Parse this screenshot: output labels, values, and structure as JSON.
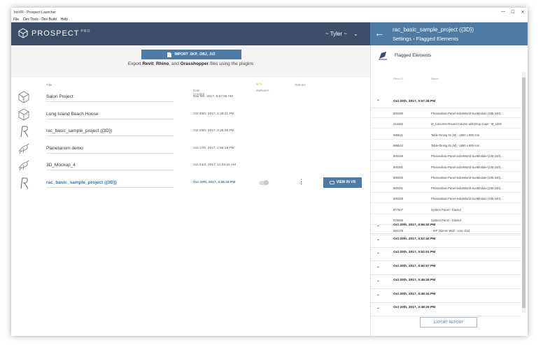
{
  "window": {
    "title": "IrisVR - Prospect Launcher",
    "controls": [
      "—",
      "☐",
      "✕"
    ]
  },
  "menu": [
    "File",
    "Dev Tools - Dev Build",
    "Help"
  ],
  "header": {
    "logo_text": "PROSPECT",
    "logo_suffix": "PRO",
    "user": "~ Tyler ~",
    "user_chevron": "⌄"
  },
  "import": {
    "button_label": "IMPORT .SKP, .OBJ, .IVZ",
    "hint_prefix": "Export ",
    "hint_revit": "Revit",
    "hint_sep1": ", ",
    "hint_rhino": "Rhino",
    "hint_sep2": ", and ",
    "hint_grasshopper": "Grasshopper",
    "hint_suffix": " files using the plugins"
  },
  "table": {
    "col_title": "Title",
    "col_date": "Date Created",
    "col_date_sort": "⌄",
    "col_multiuser": "Multiuser",
    "col_multiuser_badge": "BETA",
    "col_options": "Options",
    "rows": [
      {
        "name": "Salon Project",
        "date": "Nov 6th, 2017, 9:57:56 AM",
        "thumb": "cube"
      },
      {
        "name": "Long Island Beach House",
        "date": "Oct 30th, 2017, 1:29:41 PM",
        "thumb": "cube"
      },
      {
        "name": "rac_basic_sample_project ({3D})",
        "date": "Oct 20th, 2017, 3:25:26 PM",
        "thumb": "revit"
      },
      {
        "name": "Planetarium demo",
        "date": "Oct 17th, 2017, 2:56:19 PM",
        "thumb": "bird"
      },
      {
        "name": "3D_Mockup_4",
        "date": "Oct 23rd, 2017, 11:03:24 AM",
        "thumb": "bird"
      },
      {
        "name": "rac_basic_sample_project ({3D})",
        "date": "Oct 20th, 2017, 3:35:28 PM",
        "thumb": "revit"
      }
    ],
    "view_vr_label": "VIEW IN VR",
    "kebab": "⋮"
  },
  "panel": {
    "back": "←",
    "title": "rac_basic_sample_project ({3D})",
    "breadcrumb": "Settings › Flagged Elements",
    "section_title": "Flagged Elements",
    "col_revit_id": "Revit ID",
    "col_name": "Name",
    "expanded_group": "Oct 20th, 2017, 3:57:28 PM",
    "items": [
      {
        "id": "800280",
        "name": "Photovoltaic-Panel-SolarWorld-SunModule-(235-240)..."
      },
      {
        "id": "414482",
        "name": "M_Concrete-Round-Column with Drop Caps - M_1000"
      },
      {
        "id": "985521",
        "name": "Table-Dining 01 (M) - 1800 x 900 mm"
      },
      {
        "id": "985544",
        "name": "Table-Dining 01 (M) - 1800 x 900 mm"
      },
      {
        "id": "800348",
        "name": "Photovoltaic-Panel-SolarWorld-SunModule-(235-240)..."
      },
      {
        "id": "800381",
        "name": "Photovoltaic-Panel-SolarWorld-SunModule-(235-240)..."
      },
      {
        "id": "800340",
        "name": "Photovoltaic-Panel-SolarWorld-SunModule-(235-240)..."
      },
      {
        "id": "800391",
        "name": "Photovoltaic-Panel-SolarWorld-SunModule-(235-240)..."
      },
      {
        "id": "800329",
        "name": "Photovoltaic-Panel-SolarWorld-SunModule-(235-240)..."
      },
      {
        "id": "977507",
        "name": "System Panel - Glazed"
      },
      {
        "id": "976946",
        "name": "System Panel - Glazed"
      },
      {
        "id": "550178",
        "name": "- SIP 202mm Wall - conc clad"
      }
    ],
    "collapsed_groups": [
      "Oct 20th, 2017, 3:55:32 PM",
      "Oct 20th, 2017, 3:52:44 PM",
      "Oct 20th, 2017, 3:52:01 PM",
      "Oct 20th, 2017, 3:50:57 PM",
      "Oct 20th, 2017, 3:49:29 PM",
      "Oct 20th, 2017, 3:49:34 PM",
      "Oct 20th, 2017, 3:48:25 PM"
    ],
    "chev_up": "⌃",
    "chev_down": "⌄",
    "export_label": "EXPORT REPORT"
  },
  "colors": {
    "header_dark": "#3d4f68",
    "accent_blue": "#4e7ba4",
    "link_blue": "#3c74b0"
  }
}
